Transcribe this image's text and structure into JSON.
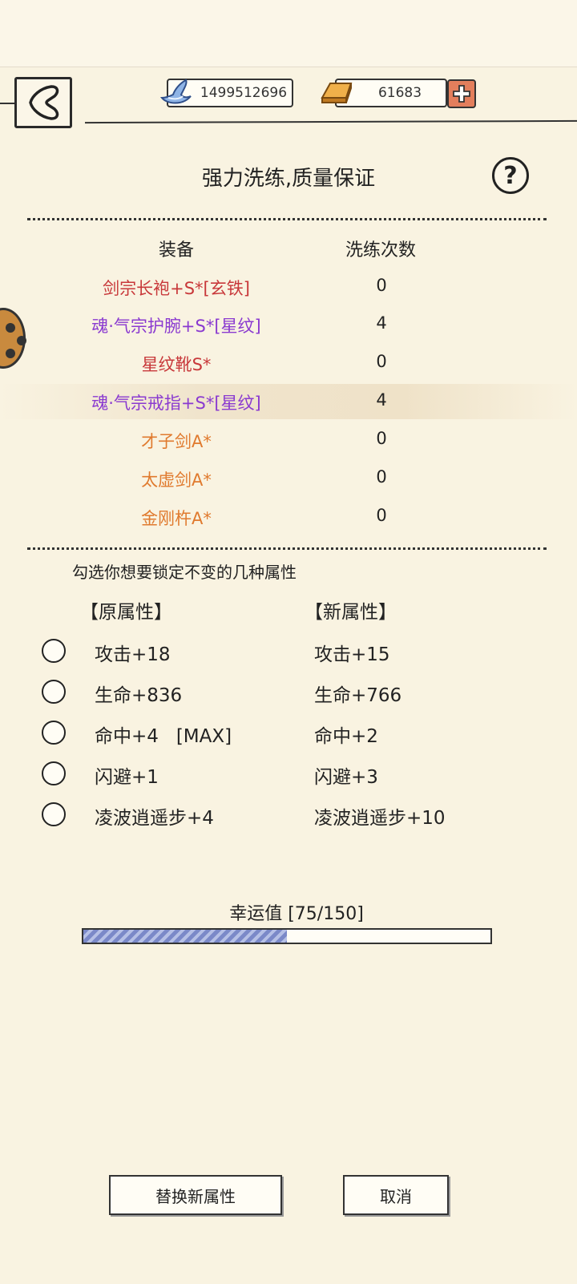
{
  "currency": {
    "silver": "1499512696",
    "gold": "61683"
  },
  "title": "强力洗练,质量保证",
  "help_label": "?",
  "table": {
    "headers": [
      "装备",
      "洗练次数"
    ],
    "rows": [
      {
        "name": "剑宗长袍+S*[玄铁]",
        "count": "0",
        "color": "#c8383a"
      },
      {
        "name": "魂·气宗护腕+S*[星纹]",
        "count": "4",
        "color": "#8a3ad0"
      },
      {
        "name": "星纹靴S*",
        "count": "0",
        "color": "#c8383a"
      },
      {
        "name": "魂·气宗戒指+S*[星纹]",
        "count": "4",
        "color": "#8a3ad0"
      },
      {
        "name": "才子剑A*",
        "count": "0",
        "color": "#e07a2e"
      },
      {
        "name": "太虚剑A*",
        "count": "0",
        "color": "#e07a2e"
      },
      {
        "name": "金刚杵A*",
        "count": "0",
        "color": "#e07a2e"
      }
    ]
  },
  "lock_hint": "勾选你想要锁定不变的几种属性",
  "attributes": {
    "old_header": "【原属性】",
    "new_header": "【新属性】",
    "rows": [
      {
        "old": "攻击+18",
        "new": "攻击+15"
      },
      {
        "old": "生命+836",
        "new": "生命+766"
      },
      {
        "old": "命中+4   [MAX]",
        "new": "命中+2"
      },
      {
        "old": "闪避+1",
        "new": "闪避+3"
      },
      {
        "old": "凌波逍遥步+4",
        "new": "凌波逍遥步+10"
      }
    ]
  },
  "luck": {
    "label": "幸运值 [75/150]",
    "current": 75,
    "max": 150
  },
  "buttons": {
    "replace": "替换新属性",
    "cancel": "取消"
  }
}
